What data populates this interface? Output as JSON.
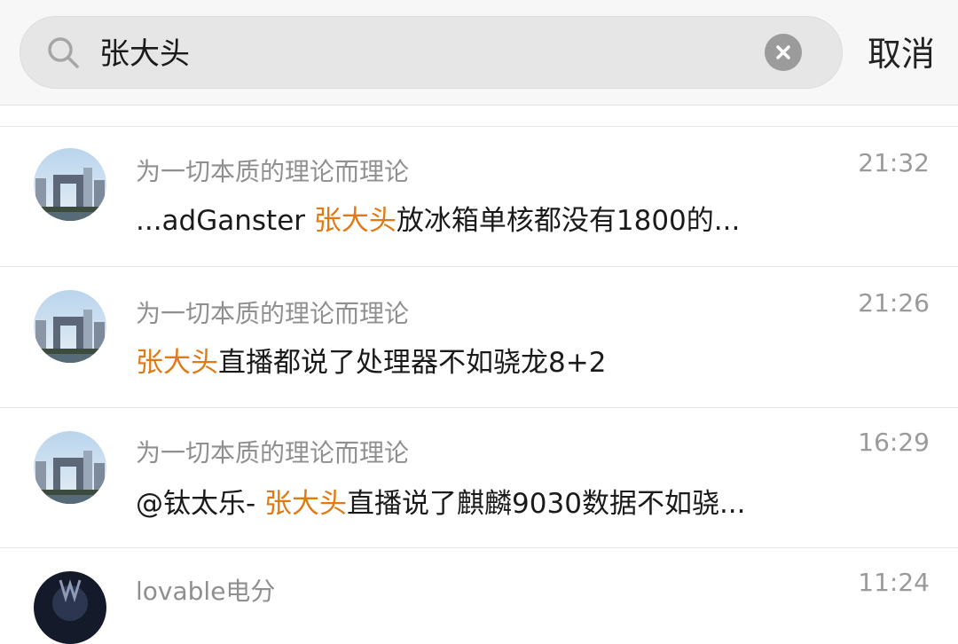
{
  "search": {
    "query": "张大头",
    "cancel_label": "取消"
  },
  "results": [
    {
      "name": "为一切本质的理论而理论",
      "time": "21:32",
      "before": "...adGanster ",
      "highlight": "张大头",
      "after": "放冰箱单核都没有1800的..."
    },
    {
      "name": "为一切本质的理论而理论",
      "time": "21:26",
      "before": "",
      "highlight": "张大头",
      "after": "直播都说了处理器不如骁龙8+2"
    },
    {
      "name": "为一切本质的理论而理论",
      "time": "16:29",
      "before": "@钛太乐- ",
      "highlight": "张大头",
      "after": "直播说了麒麟9030数据不如骁..."
    },
    {
      "name": "lovable电分",
      "time": "11:24"
    }
  ],
  "colors": {
    "highlight": "#e07a14",
    "name": "#8f8f8f",
    "time": "#9a9a9a",
    "search_bg": "#e6e6e6"
  },
  "icons": [
    "search-icon",
    "clear-icon",
    "avatar-building",
    "avatar-dark"
  ]
}
